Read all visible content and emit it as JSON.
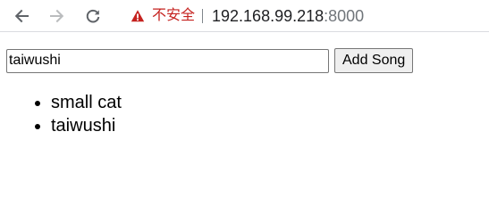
{
  "browser": {
    "security_label": "不安全",
    "url_host": "192.168.99.218",
    "url_port": ":8000"
  },
  "form": {
    "input_value": "taiwushi",
    "button_label": "Add Song"
  },
  "songs": [
    "small cat",
    "taiwushi"
  ]
}
